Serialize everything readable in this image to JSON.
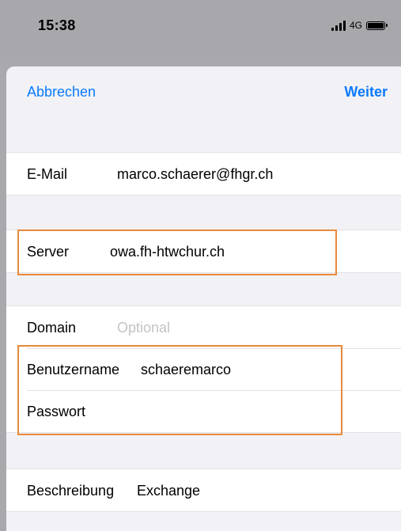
{
  "status_bar": {
    "time": "15:38",
    "network": "4G",
    "signal_icon": "cellular-signal-icon",
    "battery_icon": "battery-icon"
  },
  "nav": {
    "cancel_label": "Abbrechen",
    "next_label": "Weiter"
  },
  "form": {
    "email": {
      "label": "E-Mail",
      "value": "marco.schaerer@fhgr.ch"
    },
    "server": {
      "label": "Server",
      "value": "owa.fh-htwchur.ch"
    },
    "domain": {
      "label": "Domain",
      "placeholder": "Optional"
    },
    "username": {
      "label": "Benutzername",
      "value": "schaeremarco"
    },
    "password": {
      "label": "Passwort",
      "value": ""
    },
    "description": {
      "label": "Beschreibung",
      "value": "Exchange"
    }
  },
  "colors": {
    "accent": "#0a7aff",
    "highlight": "#e8893a",
    "backdrop": "#a9a9ad",
    "sheet_background": "#f2f2f6"
  }
}
